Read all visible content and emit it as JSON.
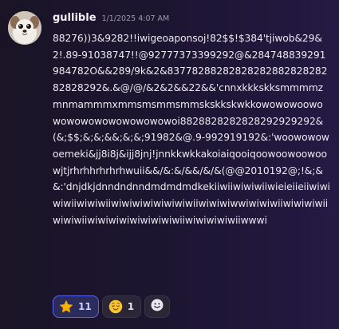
{
  "message": {
    "author": "gullible",
    "timestamp": "1/1/2025 4:07 AM",
    "content": "88276))3&9282!!iwigeoaponsoj!82$$!$384'tjiwob&29&2!.89-91038747!!@92777373399292@&284748839291984782O&&289/9k&2&8377828828282828288282828282828292&.&@/@/&2&2&&22&&'cnnxkkkskksmmmmzmnmammmxmmsmsmmsmmskskkskwkkowowowoowowowowowowowowowowoi8828828282828292929292&(&;$$;&;&;&&;&;&;91982&@.9-992919192&:'woowowowoemeki&jj8i8j&ijj8jnj!jnnkkwkkakoiaiqooiqoowoowoowoowjtjrhrhhrhrhrhwuii&&/&:&/&&/&/&(@@2010192@;!&;&&:'dnjdkjdnndndnndmdmdmdkekiiwiiwiwiwiiwieieiieiiwiwiwiwiiwiwiwiiwiwiwiwiwiwiwiwiiwiwiwiwwiwiwiwiiwiwiwiwiiwiwiwiiwiwiwiwiwiwiwiwiwiiwiwiwiwiwiiwwwi"
  },
  "reactions": [
    {
      "emoji": "star-emoji",
      "count": "11",
      "active": true
    },
    {
      "emoji": "relieved-face-emoji",
      "count": "1",
      "active": false
    }
  ],
  "add_reaction": {
    "icon": "add-reaction-icon"
  },
  "colors": {
    "accent": "#5865f2",
    "active_reaction_bg": "#2b2c5c",
    "reaction_bg": "#2a2636",
    "star": "#f5b301",
    "face": "#f7c531"
  }
}
